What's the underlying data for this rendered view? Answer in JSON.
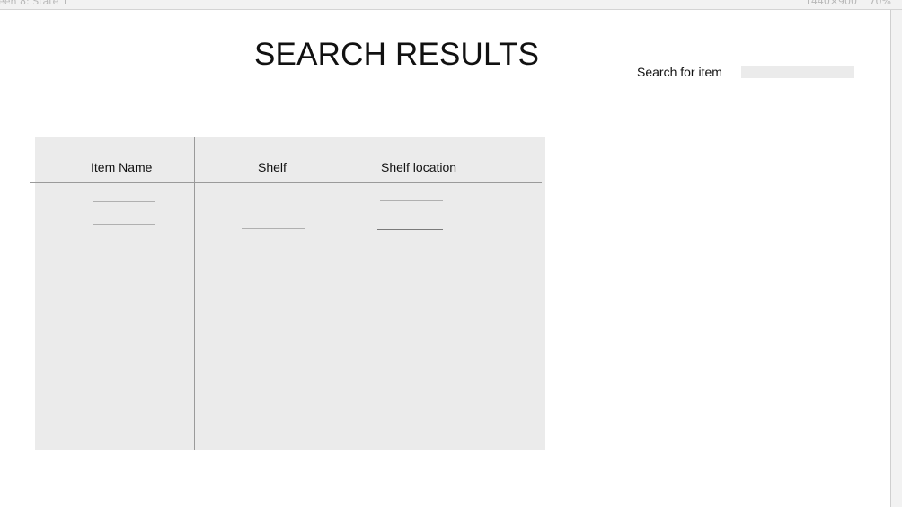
{
  "topbar": {
    "screen_label": "een 8: State 1",
    "dimensions": "1440×900",
    "zoom": "70%"
  },
  "page": {
    "title": "SEARCH RESULTS"
  },
  "search": {
    "label": "Search for item",
    "value": ""
  },
  "table": {
    "columns": [
      "Item Name",
      "Shelf",
      "Shelf location"
    ]
  }
}
